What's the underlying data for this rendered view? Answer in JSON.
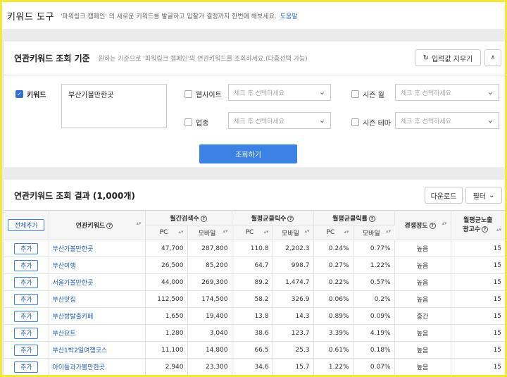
{
  "header": {
    "title": "키워드 도구",
    "description": "'파워링크 캠페인' 의 새로운 키워드를 발굴하고 입찰가 결정까지 한번에 해보세요.",
    "help_link": "도움말"
  },
  "query_panel": {
    "title": "연관키워드 조회 기준",
    "subtitle": "원하는 기준으로 '파워링크 캠페인'의 연관키워드를 조회하세요.(다중선택 가능)",
    "reset_label": "입력값 지우기",
    "keyword_label": "키워드",
    "keyword_value": "부산가볼만한곳",
    "website_label": "웹사이트",
    "industry_label": "업종",
    "season_month_label": "시즌 월",
    "season_theme_label": "시즌 테마",
    "select_placeholder": "체크 후 선택하세요",
    "search_button": "조회하기"
  },
  "results": {
    "title": "연관키워드 조회 결과 (1,000개)",
    "download_label": "다운로드",
    "filter_label": "필터",
    "add_all_label": "전체추가",
    "add_label": "추가",
    "columns": {
      "keyword": "연관키워드",
      "monthly_search": "월간검색수",
      "avg_clicks": "월평균클릭수",
      "avg_ctr": "월평균클릭률",
      "competition": "경쟁정도",
      "avg_ads_line1": "월평균노출",
      "avg_ads_line2": "광고수",
      "pc": "PC",
      "mobile": "모바일"
    },
    "rows": [
      {
        "keyword": "부산가볼만한곳",
        "search_pc": "47,700",
        "search_mobile": "287,800",
        "clicks_pc": "110.8",
        "clicks_mobile": "2,202.3",
        "ctr_pc": "0.24%",
        "ctr_mobile": "0.77%",
        "competition": "높음",
        "ads": "15"
      },
      {
        "keyword": "부산여행",
        "search_pc": "26,500",
        "search_mobile": "85,200",
        "clicks_pc": "64.7",
        "clicks_mobile": "998.7",
        "ctr_pc": "0.27%",
        "ctr_mobile": "1.22%",
        "competition": "높음",
        "ads": "15"
      },
      {
        "keyword": "서울가볼만한곳",
        "search_pc": "44,000",
        "search_mobile": "269,300",
        "clicks_pc": "89.2",
        "clicks_mobile": "1,474.7",
        "ctr_pc": "0.22%",
        "ctr_mobile": "0.57%",
        "competition": "높음",
        "ads": "15"
      },
      {
        "keyword": "부산맛집",
        "search_pc": "112,500",
        "search_mobile": "174,500",
        "clicks_pc": "58.2",
        "clicks_mobile": "326.9",
        "ctr_pc": "0.06%",
        "ctr_mobile": "0.2%",
        "competition": "높음",
        "ads": "15"
      },
      {
        "keyword": "부산방탈출카페",
        "search_pc": "1,650",
        "search_mobile": "19,400",
        "clicks_pc": "13.8",
        "clicks_mobile": "14.3",
        "ctr_pc": "0.89%",
        "ctr_mobile": "0.09%",
        "competition": "중간",
        "ads": "15"
      },
      {
        "keyword": "부산요트",
        "search_pc": "1,280",
        "search_mobile": "3,040",
        "clicks_pc": "38.6",
        "clicks_mobile": "123.7",
        "ctr_pc": "3.39%",
        "ctr_mobile": "4.19%",
        "competition": "높음",
        "ads": "15"
      },
      {
        "keyword": "부산1박2일여행코스",
        "search_pc": "11,100",
        "search_mobile": "14,800",
        "clicks_pc": "66.5",
        "clicks_mobile": "25.3",
        "ctr_pc": "0.61%",
        "ctr_mobile": "0.18%",
        "competition": "높음",
        "ads": "15"
      },
      {
        "keyword": "아이들과가볼만한곳",
        "search_pc": "2,940",
        "search_mobile": "23,300",
        "clicks_pc": "34.6",
        "clicks_mobile": "15.7",
        "ctr_pc": "1.22%",
        "ctr_mobile": "0.07%",
        "competition": "높음",
        "ads": "15"
      }
    ]
  }
}
